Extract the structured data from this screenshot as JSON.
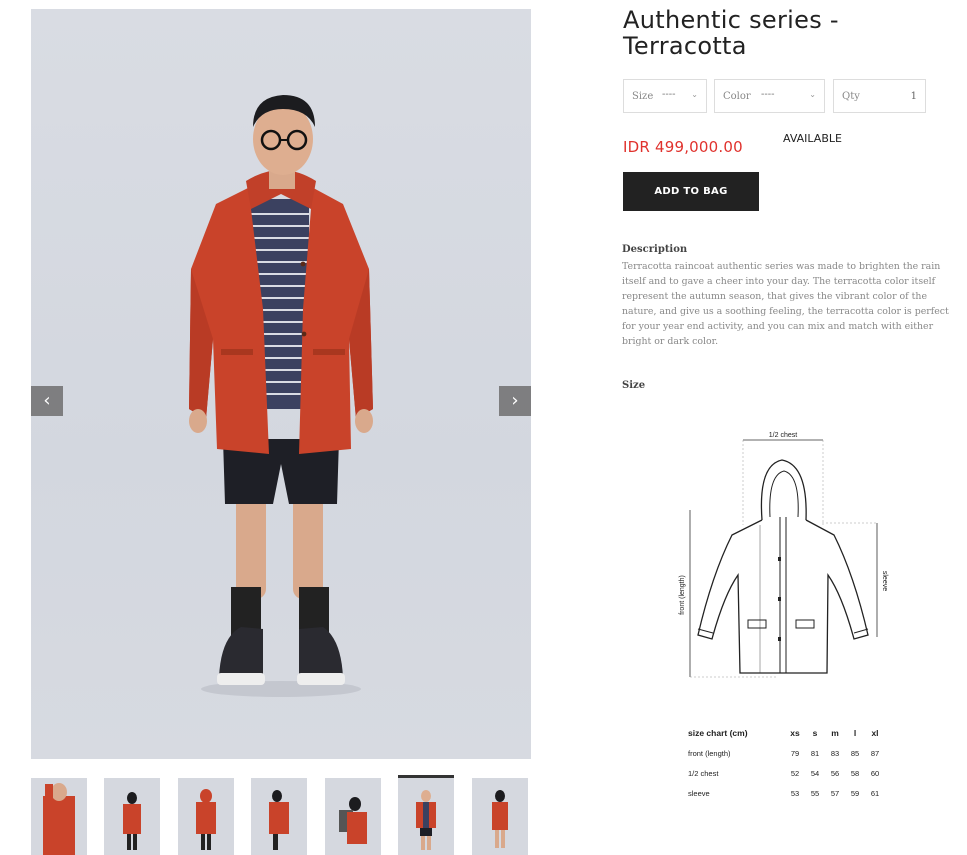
{
  "product": {
    "title": "Authentic series - Terracotta",
    "price": "IDR 499,000.00",
    "availability": "AVAILABLE",
    "add_to_bag_label": "ADD TO BAG"
  },
  "options": {
    "size": {
      "label": "Size",
      "value": "----"
    },
    "color": {
      "label": "Color",
      "value": "----"
    },
    "qty": {
      "label": "Qty",
      "value": "1"
    }
  },
  "description": {
    "heading": "Description",
    "text": "Terracotta raincoat authentic series was made to brighten the rain itself and to gave a cheer into your day. The terracotta color itself represent the autumn season, that gives the vibrant color of the nature, and give us a soothing feeling, the terracotta color is perfect for your year end activity, and you can mix and match with either bright or dark color."
  },
  "size_section": {
    "heading": "Size",
    "diagram_labels": {
      "chest": "1/2 chest",
      "front": "front (length)",
      "sleeve": "sleeve"
    },
    "table": {
      "header": [
        "size chart (cm)",
        "xs",
        "s",
        "m",
        "l",
        "xl"
      ],
      "rows": [
        [
          "front (length)",
          "79",
          "81",
          "83",
          "85",
          "87"
        ],
        [
          "1/2 chest",
          "52",
          "54",
          "56",
          "58",
          "60"
        ],
        [
          "sleeve",
          "53",
          "55",
          "57",
          "59",
          "61"
        ]
      ]
    }
  },
  "gallery": {
    "prev_icon": "chevron-left-icon",
    "next_icon": "chevron-right-icon",
    "thumbnails": [
      "pose-hood",
      "front-long",
      "front-hood",
      "side",
      "back-pack",
      "front-open",
      "side-walk"
    ],
    "active_index": 5
  },
  "colors": {
    "jacket": "#c9432a",
    "price": "#e0322d",
    "button": "#222222"
  }
}
